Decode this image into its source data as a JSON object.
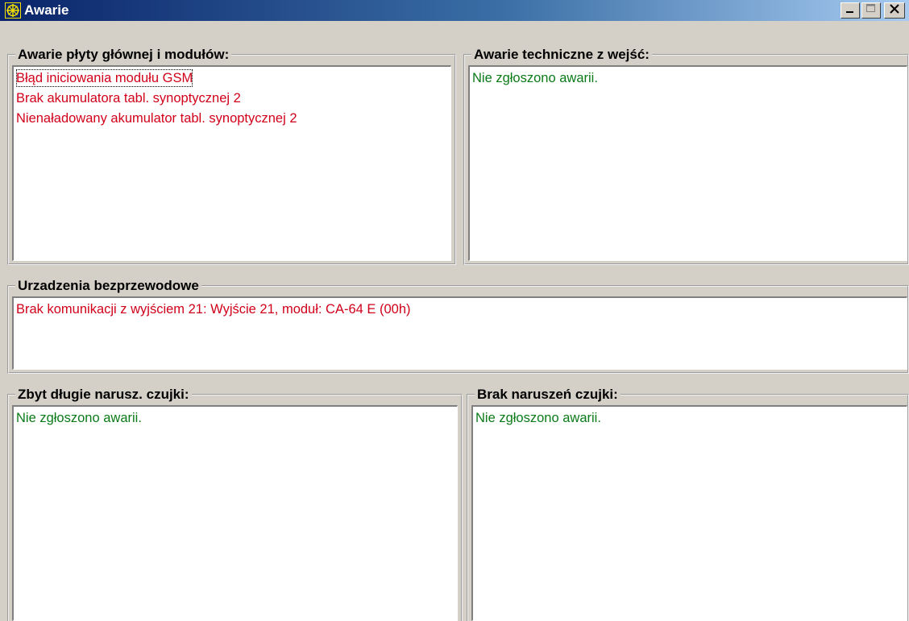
{
  "window": {
    "title": "Awarie",
    "icon": "keypad-app-icon"
  },
  "groups": {
    "mainboard": {
      "title": "Awarie płyty głównej i modułów:",
      "items": [
        "Błąd iniciowania modułu GSM",
        "Brak akumulatora tabl. synoptycznej 2",
        "Nienaładowany akumulator tabl. synoptycznej 2"
      ]
    },
    "technical": {
      "title": "Awarie techniczne z wejść:",
      "items": [
        "Nie zgłoszono awarii."
      ]
    },
    "wireless": {
      "title": "Urzadzenia bezprzewodowe",
      "items": [
        "Brak komunikacji z wyjściem 21: Wyjście  21, moduł: CA-64 E   (00h)"
      ]
    },
    "long_violation": {
      "title": "Zbyt długie narusz. czujki:",
      "items": [
        "Nie zgłoszono awarii."
      ]
    },
    "no_violation": {
      "title": "Brak naruszeń czujki:",
      "items": [
        "Nie zgłoszono awarii."
      ]
    }
  },
  "colors": {
    "fault": "#d1001a",
    "ok": "#0b7a18",
    "title_bar": "#0a246a"
  }
}
